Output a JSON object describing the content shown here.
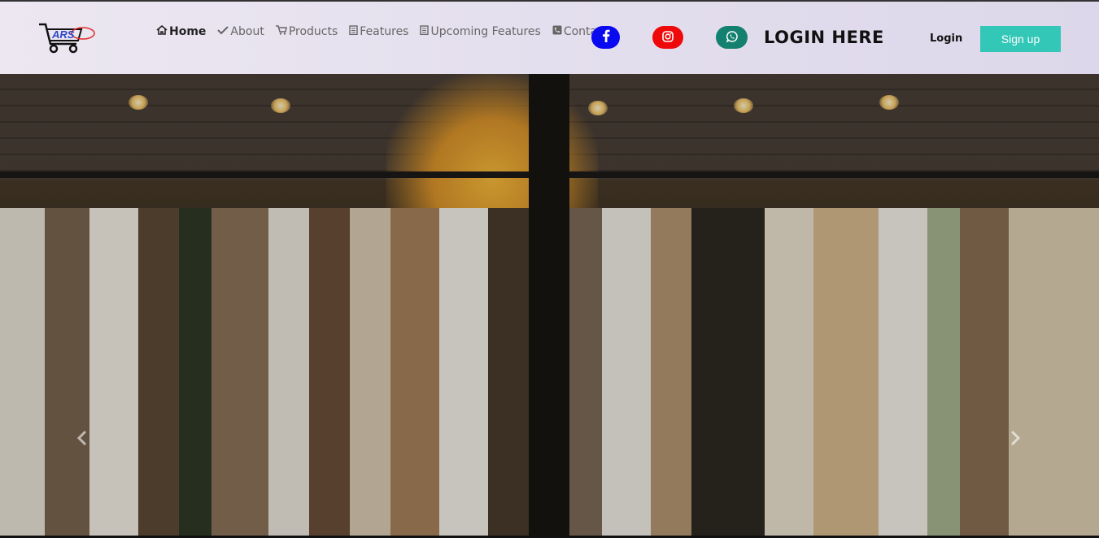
{
  "brand": {
    "logo_text": "ARS"
  },
  "nav": {
    "items": [
      {
        "label": "Home",
        "icon": "home-icon",
        "active": true
      },
      {
        "label": "About",
        "icon": "check-icon",
        "active": false
      },
      {
        "label": "Products",
        "icon": "cart-icon",
        "active": false
      },
      {
        "label": "Features",
        "icon": "clipboard-icon",
        "active": false
      },
      {
        "label": "Upcoming Features",
        "icon": "clipboard-icon",
        "active": false
      },
      {
        "label": "Contact",
        "icon": "phone-icon",
        "active": false
      }
    ]
  },
  "social": {
    "facebook_icon": "facebook-icon",
    "instagram_icon": "instagram-icon",
    "whatsapp_icon": "whatsapp-icon",
    "colors": {
      "facebook": "#0a0af0",
      "instagram": "#ee0a0a",
      "whatsapp": "#138070"
    }
  },
  "header": {
    "login_here": "LOGIN HERE",
    "login_label": "Login",
    "signup_label": "Sign up"
  },
  "carousel": {
    "prev_icon": "chevron-left-icon",
    "next_icon": "chevron-right-icon"
  },
  "colors": {
    "accent": "#33c7b7"
  }
}
